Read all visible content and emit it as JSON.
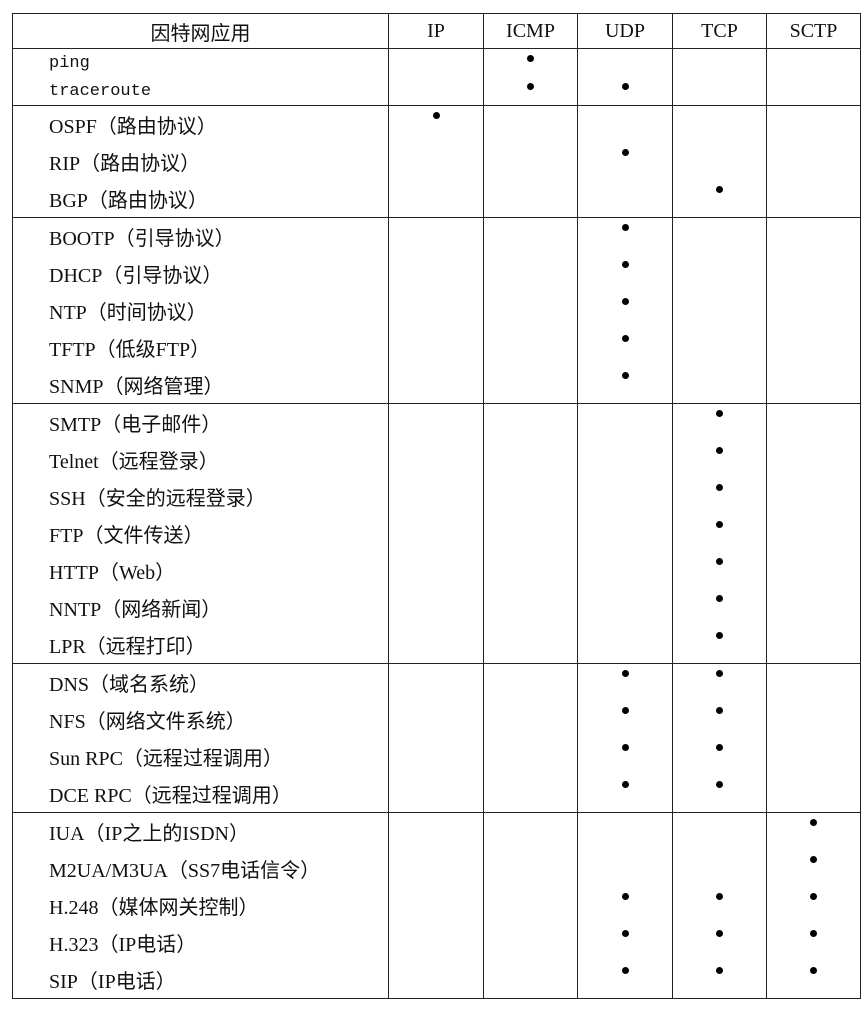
{
  "headers": [
    "因特网应用",
    "IP",
    "ICMP",
    "UDP",
    "TCP",
    "SCTP"
  ],
  "groups": [
    {
      "mono": true,
      "rows": [
        {
          "name": "ping",
          "marks": [
            false,
            true,
            false,
            false,
            false
          ]
        },
        {
          "name": "traceroute",
          "marks": [
            false,
            true,
            true,
            false,
            false
          ]
        }
      ]
    },
    {
      "mono": false,
      "rows": [
        {
          "name": "OSPF（路由协议）",
          "marks": [
            true,
            false,
            false,
            false,
            false
          ]
        },
        {
          "name": "RIP（路由协议）",
          "marks": [
            false,
            false,
            true,
            false,
            false
          ]
        },
        {
          "name": "BGP（路由协议）",
          "marks": [
            false,
            false,
            false,
            true,
            false
          ]
        }
      ]
    },
    {
      "mono": false,
      "rows": [
        {
          "name": "BOOTP（引导协议）",
          "marks": [
            false,
            false,
            true,
            false,
            false
          ]
        },
        {
          "name": "DHCP（引导协议）",
          "marks": [
            false,
            false,
            true,
            false,
            false
          ]
        },
        {
          "name": "NTP（时间协议）",
          "marks": [
            false,
            false,
            true,
            false,
            false
          ]
        },
        {
          "name": "TFTP（低级FTP）",
          "marks": [
            false,
            false,
            true,
            false,
            false
          ]
        },
        {
          "name": "SNMP（网络管理）",
          "marks": [
            false,
            false,
            true,
            false,
            false
          ]
        }
      ]
    },
    {
      "mono": false,
      "rows": [
        {
          "name": "SMTP（电子邮件）",
          "marks": [
            false,
            false,
            false,
            true,
            false
          ]
        },
        {
          "name": "Telnet（远程登录）",
          "marks": [
            false,
            false,
            false,
            true,
            false
          ]
        },
        {
          "name": "SSH（安全的远程登录）",
          "marks": [
            false,
            false,
            false,
            true,
            false
          ]
        },
        {
          "name": "FTP（文件传送）",
          "marks": [
            false,
            false,
            false,
            true,
            false
          ]
        },
        {
          "name": "HTTP（Web）",
          "marks": [
            false,
            false,
            false,
            true,
            false
          ]
        },
        {
          "name": "NNTP（网络新闻）",
          "marks": [
            false,
            false,
            false,
            true,
            false
          ]
        },
        {
          "name": "LPR（远程打印）",
          "marks": [
            false,
            false,
            false,
            true,
            false
          ]
        }
      ]
    },
    {
      "mono": false,
      "rows": [
        {
          "name": "DNS（域名系统）",
          "marks": [
            false,
            false,
            true,
            true,
            false
          ]
        },
        {
          "name": "NFS（网络文件系统）",
          "marks": [
            false,
            false,
            true,
            true,
            false
          ]
        },
        {
          "name": "Sun RPC（远程过程调用）",
          "marks": [
            false,
            false,
            true,
            true,
            false
          ]
        },
        {
          "name": "DCE RPC（远程过程调用）",
          "marks": [
            false,
            false,
            true,
            true,
            false
          ]
        }
      ]
    },
    {
      "mono": false,
      "rows": [
        {
          "name": "IUA（IP之上的ISDN）",
          "marks": [
            false,
            false,
            false,
            false,
            true
          ]
        },
        {
          "name": "M2UA/M3UA（SS7电话信令）",
          "marks": [
            false,
            false,
            false,
            false,
            true
          ]
        },
        {
          "name": "H.248（媒体网关控制）",
          "marks": [
            false,
            false,
            true,
            true,
            true
          ]
        },
        {
          "name": "H.323（IP电话）",
          "marks": [
            false,
            false,
            true,
            true,
            true
          ]
        },
        {
          "name": "SIP（IP电话）",
          "marks": [
            false,
            false,
            true,
            true,
            true
          ]
        }
      ]
    }
  ]
}
